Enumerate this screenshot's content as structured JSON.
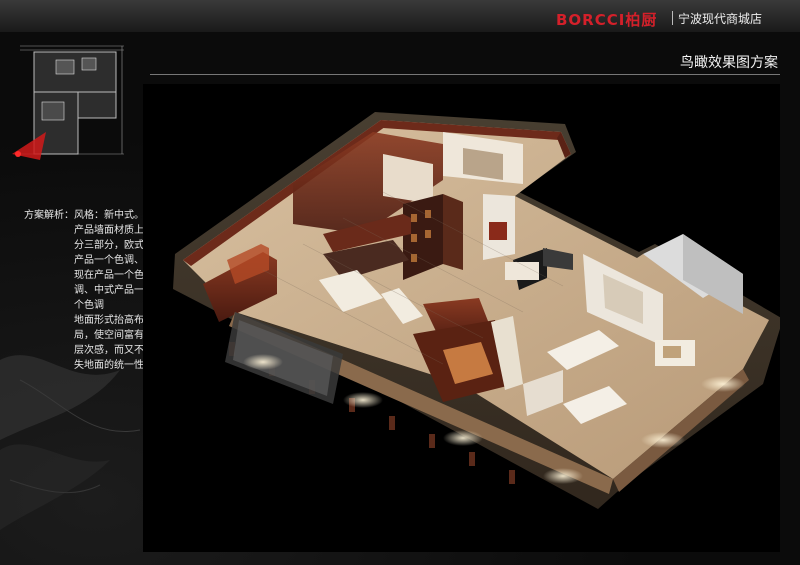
{
  "header": {
    "brand_logo": "BORCCI柏厨",
    "store_name": "宁波现代商城店"
  },
  "page_title": "鸟瞰效果图方案",
  "description": {
    "heading": "方案解析：",
    "lines": [
      "风格：新中式。",
      "产品墙面材质上",
      "分三部分，欧式",
      "产品一个色调、",
      "现在产品一个色",
      "调、中式产品一",
      "个色调",
      "地面形式抬高布",
      "局，使空间富有",
      "层次感，而又不",
      "失地面的统一性。"
    ]
  },
  "colors": {
    "brand_red": "#d4202a",
    "background": "#0b0b0b",
    "floor_warm": "#c9a57a",
    "wood_red": "#6b2a1a"
  }
}
